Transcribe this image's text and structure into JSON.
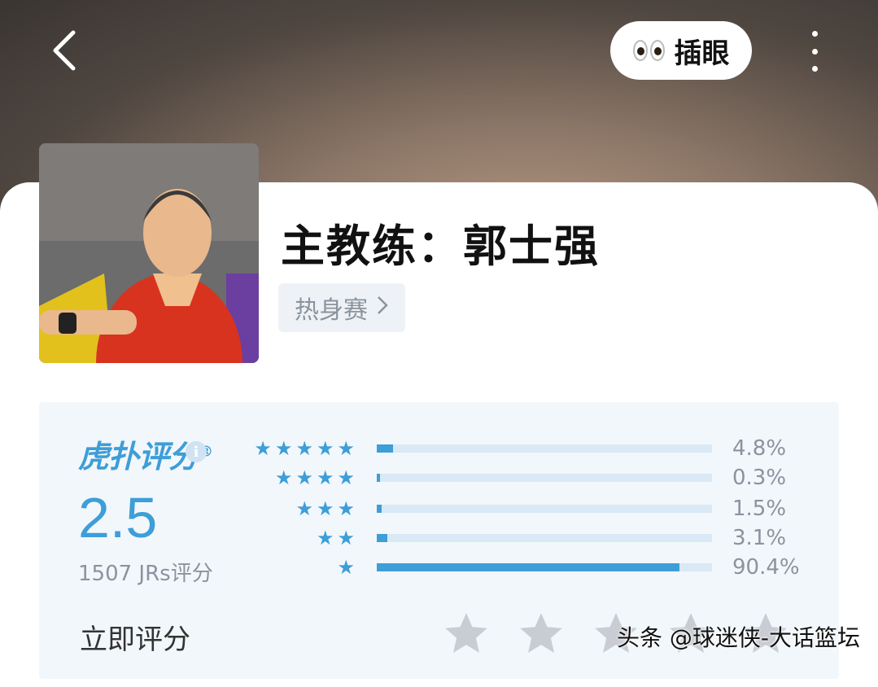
{
  "header": {
    "peek_label": "插眼"
  },
  "profile": {
    "title": "主教练：郭士强",
    "tag_label": "热身赛"
  },
  "rating": {
    "brand": "虎扑评分",
    "brand_mark": "®",
    "info_symbol": "i",
    "score": "2.5",
    "count_label": "1507 JRs评分",
    "distribution": [
      {
        "stars": "★★★★★",
        "percent_label": "4.8%",
        "fraction": 0.048
      },
      {
        "stars": "★★★★",
        "percent_label": "0.3%",
        "fraction": 0.003
      },
      {
        "stars": "★★★",
        "percent_label": "1.5%",
        "fraction": 0.015
      },
      {
        "stars": "★★",
        "percent_label": "3.1%",
        "fraction": 0.031
      },
      {
        "stars": "★",
        "percent_label": "90.4%",
        "fraction": 0.904
      }
    ],
    "rate_now_label": "立即评分",
    "rate_star_count": 5
  },
  "watermark": "头条 @球迷侠-大话篮坛",
  "colors": {
    "accent": "#3d9ed8",
    "bar_track": "#d9e9f5",
    "panel_bg": "#f2f7fb",
    "muted_text": "#8a939e",
    "empty_star": "#c9cdd3"
  }
}
